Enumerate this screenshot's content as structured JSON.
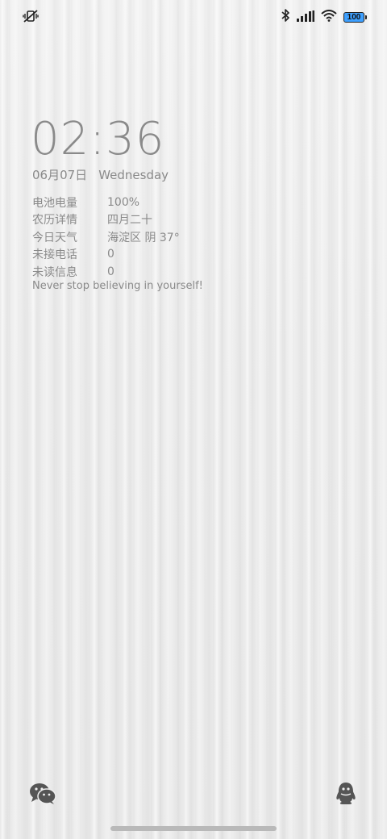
{
  "status_bar": {
    "battery_level": "100",
    "icons": [
      "vibrate-off-icon",
      "bluetooth-icon",
      "signal-icon",
      "wifi-icon",
      "battery-icon"
    ]
  },
  "lockscreen": {
    "time": "02:36",
    "date": "06月07日",
    "weekday": "Wednesday",
    "info": [
      {
        "label": "电池电量",
        "value": "100%"
      },
      {
        "label": "农历详情",
        "value": "四月二十"
      },
      {
        "label": "今日天气",
        "value": "海淀区 阴 37°"
      },
      {
        "label": "未接电话",
        "value": "0"
      },
      {
        "label": "未读信息",
        "value": "0"
      }
    ],
    "motto": "Never stop believing in yourself!"
  },
  "shortcuts": {
    "left": "wechat-icon",
    "right": "qq-icon"
  },
  "colors": {
    "text": "#8a8a8a",
    "battery_fill": "#3ea0ff",
    "background": "#eeeeee"
  }
}
